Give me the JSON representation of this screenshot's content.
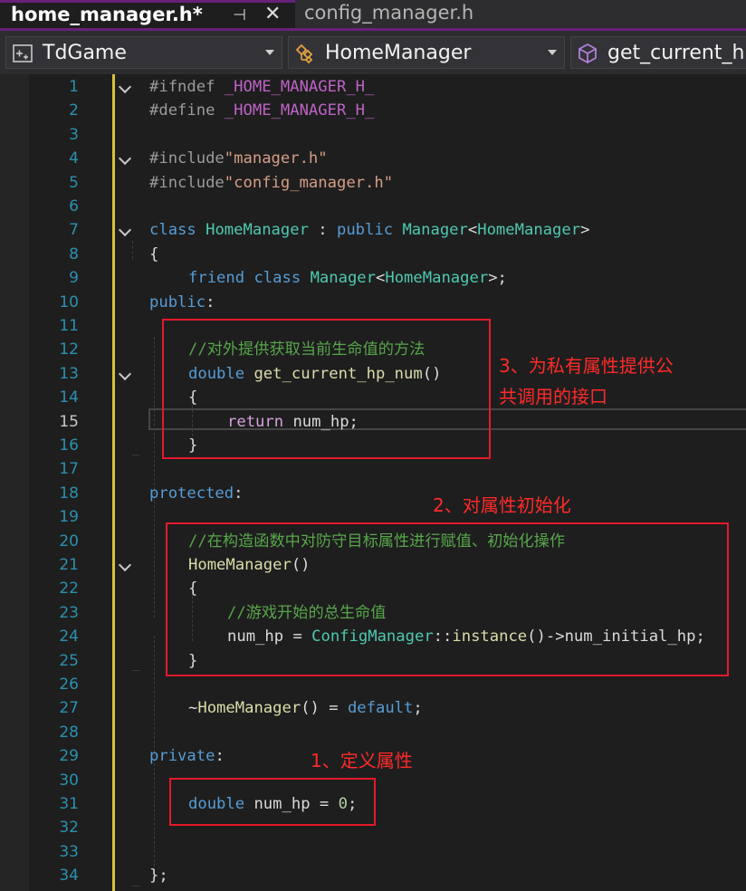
{
  "tabs": {
    "active_label": "home_manager.h*",
    "pin_glyph": "⊣",
    "close_glyph": "✕",
    "inactive_label": "config_manager.h"
  },
  "navigation": {
    "project": "TdGame",
    "class": "HomeManager",
    "member": "get_current_h"
  },
  "current_line": "15",
  "lines": [
    {
      "n": "1"
    },
    {
      "n": "2"
    },
    {
      "n": "3"
    },
    {
      "n": "4"
    },
    {
      "n": "5"
    },
    {
      "n": "6"
    },
    {
      "n": "7"
    },
    {
      "n": "8"
    },
    {
      "n": "9"
    },
    {
      "n": "10"
    },
    {
      "n": "11"
    },
    {
      "n": "12"
    },
    {
      "n": "13"
    },
    {
      "n": "14"
    },
    {
      "n": "15"
    },
    {
      "n": "16"
    },
    {
      "n": "17"
    },
    {
      "n": "18"
    },
    {
      "n": "19"
    },
    {
      "n": "20"
    },
    {
      "n": "21"
    },
    {
      "n": "22"
    },
    {
      "n": "23"
    },
    {
      "n": "24"
    },
    {
      "n": "25"
    },
    {
      "n": "26"
    },
    {
      "n": "27"
    },
    {
      "n": "28"
    },
    {
      "n": "29"
    },
    {
      "n": "30"
    },
    {
      "n": "31"
    },
    {
      "n": "32"
    },
    {
      "n": "33"
    },
    {
      "n": "34"
    }
  ],
  "code": {
    "l1_kw": "#ifndef",
    "l1_mac": "_HOME_MANAGER_H_",
    "l2_kw": "#define",
    "l2_mac": "_HOME_MANAGER_H_",
    "l4_kw": "#include",
    "l4_str": "\"manager.h\"",
    "l5_kw": "#include",
    "l5_str": "\"config_manager.h\"",
    "l7_class": "class",
    "l7_name": "HomeManager",
    "l7_colon": " : ",
    "l7_public": "public",
    "l7_base": "Manager",
    "l7_lt": "<",
    "l7_targ": "HomeManager",
    "l7_gt": ">",
    "l8_brace": "{",
    "l9_friend": "friend",
    "l9_class": "class",
    "l9_base": "Manager",
    "l9_lt": "<",
    "l9_targ": "HomeManager",
    "l9_end": ">;",
    "l10_access": "public",
    "l10_colon": ":",
    "l12_comment": "//对外提供获取当前生命值的方法",
    "l13_type": "double",
    "l13_fn": "get_current_hp_num",
    "l13_paren": "()",
    "l14_brace": "{",
    "l15_return": "return",
    "l15_member": "num_hp",
    "l15_semi": ";",
    "l16_brace": "}",
    "l18_access": "protected",
    "l18_colon": ":",
    "l20_comment": "//在构造函数中对防守目标属性进行赋值、初始化操作",
    "l21_fn": "HomeManager",
    "l21_paren": "()",
    "l22_brace": "{",
    "l23_comment": "//游戏开始的总生命值",
    "l24_member": "num_hp",
    "l24_eq": " = ",
    "l24_type": "ConfigManager",
    "l24_scope": "::",
    "l24_fn": "instance",
    "l24_call": "()->",
    "l24_member2": "num_initial_hp",
    "l24_semi": ";",
    "l25_brace": "}",
    "l27_tilde": "~",
    "l27_fn": "HomeManager",
    "l27_rest": "() = ",
    "l27_default": "default",
    "l27_semi": ";",
    "l29_access": "private",
    "l29_colon": ":",
    "l31_type": "double",
    "l31_member": "num_hp",
    "l31_eq": " = ",
    "l31_num": "0",
    "l31_semi": ";",
    "l34_end": "};"
  },
  "annotations": {
    "note1": "1、定义属性",
    "note2": "2、对属性初始化",
    "note3_line1": "3、为私有属性提供公",
    "note3_line2": "共调用的接口"
  },
  "colors": {
    "accent_purple": "#68217a",
    "annotation_red": "#e5192a",
    "change_marker_yellow": "#d6c23a"
  }
}
